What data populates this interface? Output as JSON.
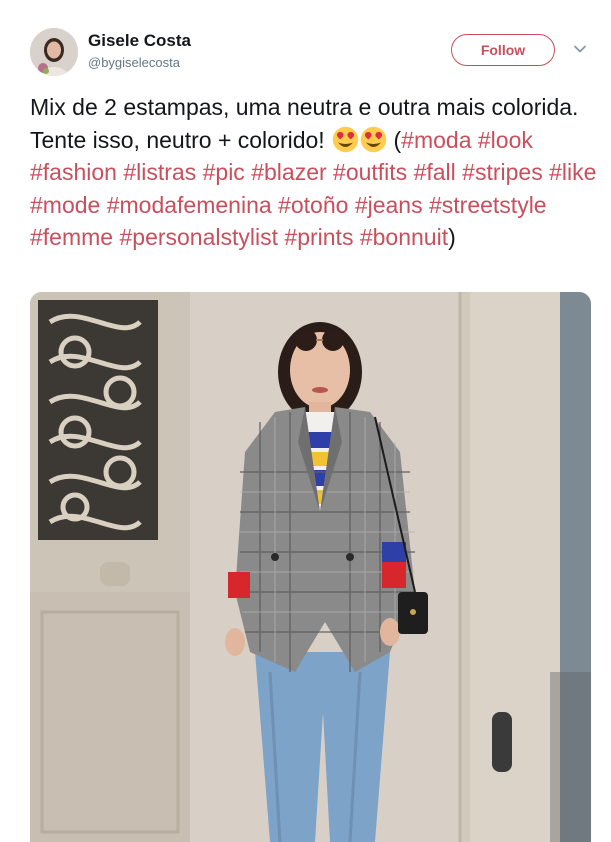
{
  "user": {
    "display_name": "Gisele Costa",
    "handle": "@bygiselecosta"
  },
  "follow_button": {
    "label": "Follow"
  },
  "tweet": {
    "lines": [
      "Mix de 2 estampas, uma neutra e outra mais",
      "colorida. Tente isso, neutro + colorido!"
    ],
    "open_paren": "(",
    "close_paren": ")",
    "hashtags": [
      "#moda",
      "#look",
      "#fashion",
      "#listras",
      "#pic",
      "#blazer",
      "#outfits",
      "#fall",
      "#stripes",
      "#like",
      "#mode",
      "#modafemenina",
      "#otoño",
      "#jeans",
      "#streetstyle",
      "#femme",
      "#personalstylist",
      "#prints",
      "#bonnuit"
    ],
    "emoji": [
      "heart-eyes-emoji",
      "heart-eyes-emoji"
    ]
  },
  "colors": {
    "hashtag": "#c94f5d",
    "follow_accent": "#c94f5d",
    "text": "#14171a",
    "secondary": "#657786"
  },
  "media": {
    "icon": "photo-woman-plaid-blazer"
  }
}
